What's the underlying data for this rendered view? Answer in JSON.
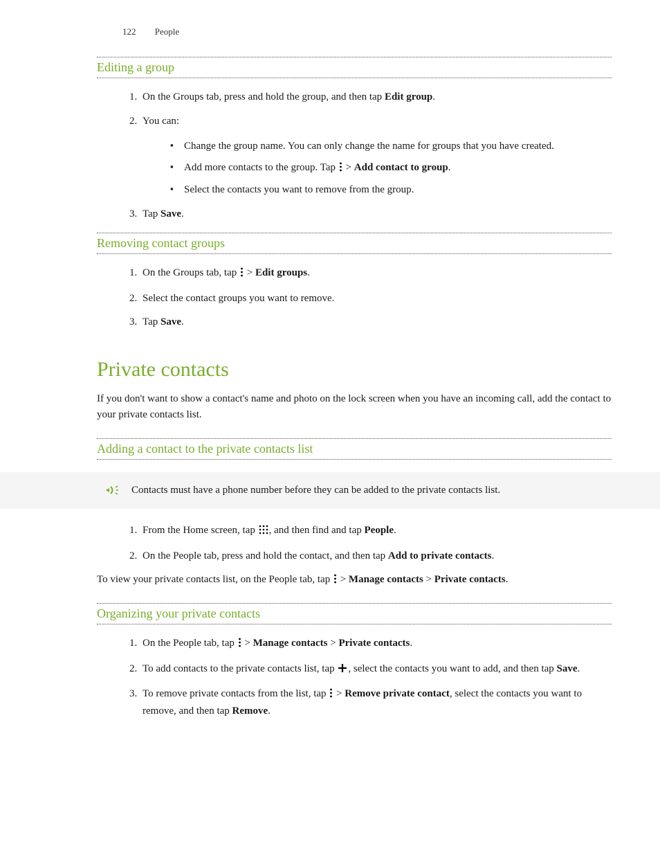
{
  "header": {
    "page_number": "122",
    "chapter": "People"
  },
  "section1": {
    "title": "Editing a group",
    "step1_a": "On the Groups tab, press and hold the group, and then tap ",
    "step1_b": "Edit group",
    "step1_c": ".",
    "step2": "You can:",
    "bullet1": "Change the group name. You can only change the name for groups that you have created.",
    "bullet2_a": "Add more contacts to the group. Tap ",
    "bullet2_b": " > ",
    "bullet2_c": "Add contact to group",
    "bullet2_d": ".",
    "bullet3": "Select the contacts you want to remove from the group.",
    "step3_a": "Tap ",
    "step3_b": "Save",
    "step3_c": "."
  },
  "section2": {
    "title": "Removing contact groups",
    "step1_a": "On the Groups tab, tap ",
    "step1_b": " > ",
    "step1_c": "Edit groups",
    "step1_d": ".",
    "step2": "Select the contact groups you want to remove.",
    "step3_a": "Tap ",
    "step3_b": "Save",
    "step3_c": "."
  },
  "section3": {
    "title": "Private contacts",
    "intro": "If you don't want to show a contact's name and photo on the lock screen when you have an incoming call, add the contact to your private contacts list."
  },
  "section4": {
    "title": "Adding a contact to the private contacts list",
    "note": "Contacts must have a phone number before they can be added to the private contacts list.",
    "step1_a": "From the Home screen, tap ",
    "step1_b": ", and then find and tap ",
    "step1_c": "People",
    "step1_d": ".",
    "step2_a": "On the People tab, press and hold the contact, and then tap ",
    "step2_b": "Add to private contacts",
    "step2_c": ".",
    "after_a": "To view your private contacts list, on the People tab, tap ",
    "after_b": " > ",
    "after_c": "Manage contacts",
    "after_d": " > ",
    "after_e": "Private contacts",
    "after_f": "."
  },
  "section5": {
    "title": "Organizing your private contacts",
    "step1_a": "On the People tab, tap ",
    "step1_b": " > ",
    "step1_c": "Manage contacts",
    "step1_d": " > ",
    "step1_e": "Private contacts",
    "step1_f": ".",
    "step2_a": "To add contacts to the private contacts list, tap ",
    "step2_b": ", select the contacts you want to add, and then tap ",
    "step2_c": "Save",
    "step2_d": ".",
    "step3_a": "To remove private contacts from the list, tap ",
    "step3_b": " > ",
    "step3_c": "Remove private contact",
    "step3_d": ", select the contacts you want to remove, and then tap ",
    "step3_e": "Remove",
    "step3_f": "."
  }
}
